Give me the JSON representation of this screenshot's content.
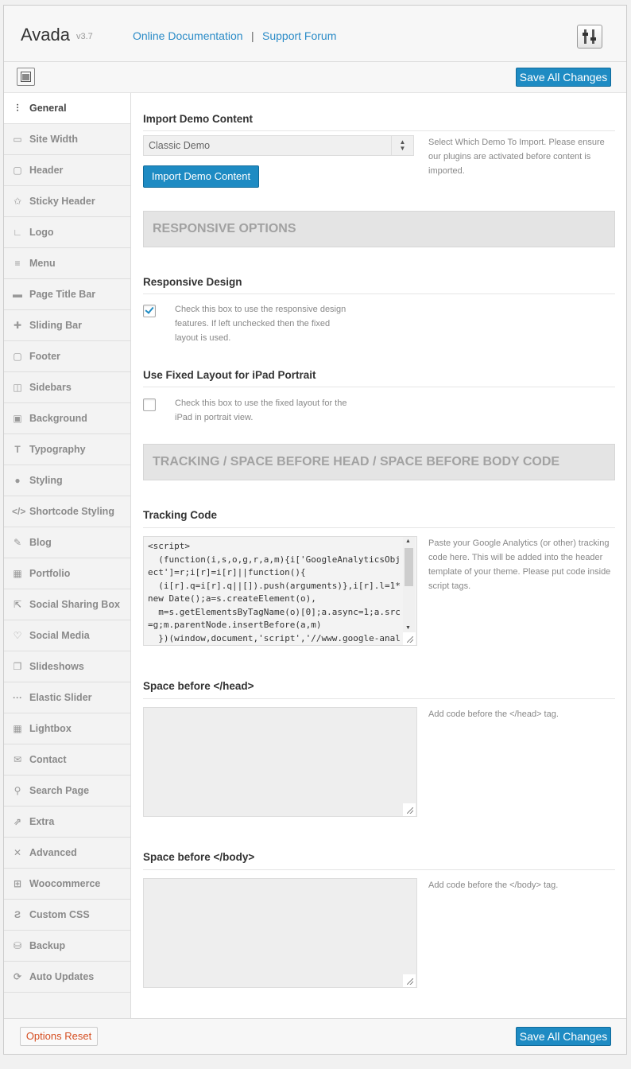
{
  "header": {
    "brand": "Avada",
    "version": "v3.7",
    "doc_link": "Online Documentation",
    "separator": "|",
    "forum_link": "Support Forum"
  },
  "toolbar": {
    "save_label": "Save All Changes"
  },
  "sidebar": {
    "items": [
      {
        "label": "General",
        "icon": "sliders-icon",
        "glyph": "⫶",
        "active": true
      },
      {
        "label": "Site Width",
        "icon": "width-icon",
        "glyph": "▭"
      },
      {
        "label": "Header",
        "icon": "header-icon",
        "glyph": "▢"
      },
      {
        "label": "Sticky Header",
        "icon": "pin-icon",
        "glyph": "✩"
      },
      {
        "label": "Logo",
        "icon": "logo-icon",
        "glyph": "∟"
      },
      {
        "label": "Menu",
        "icon": "menu-icon",
        "glyph": "≡"
      },
      {
        "label": "Page Title Bar",
        "icon": "title-bar-icon",
        "glyph": "▬"
      },
      {
        "label": "Sliding Bar",
        "icon": "plus-icon",
        "glyph": "✚"
      },
      {
        "label": "Footer",
        "icon": "footer-icon",
        "glyph": "▢"
      },
      {
        "label": "Sidebars",
        "icon": "sidebar-icon",
        "glyph": "◫"
      },
      {
        "label": "Background",
        "icon": "image-icon",
        "glyph": "▣"
      },
      {
        "label": "Typography",
        "icon": "text-icon",
        "glyph": "T"
      },
      {
        "label": "Styling",
        "icon": "drop-icon",
        "glyph": "●"
      },
      {
        "label": "Shortcode Styling",
        "icon": "code-icon",
        "glyph": "</>"
      },
      {
        "label": "Blog",
        "icon": "quill-icon",
        "glyph": "✎"
      },
      {
        "label": "Portfolio",
        "icon": "portfolio-icon",
        "glyph": "▦"
      },
      {
        "label": "Social Sharing Box",
        "icon": "share-icon",
        "glyph": "⇱"
      },
      {
        "label": "Social Media",
        "icon": "heart-icon",
        "glyph": "♡"
      },
      {
        "label": "Slideshows",
        "icon": "slides-icon",
        "glyph": "❐"
      },
      {
        "label": "Elastic Slider",
        "icon": "dots-icon",
        "glyph": "···"
      },
      {
        "label": "Lightbox",
        "icon": "lightbox-icon",
        "glyph": "▦"
      },
      {
        "label": "Contact",
        "icon": "mail-icon",
        "glyph": "✉"
      },
      {
        "label": "Search Page",
        "icon": "search-icon",
        "glyph": "⚲"
      },
      {
        "label": "Extra",
        "icon": "external-icon",
        "glyph": "⇗"
      },
      {
        "label": "Advanced",
        "icon": "wrench-icon",
        "glyph": "✕"
      },
      {
        "label": "Woocommerce",
        "icon": "cart-icon",
        "glyph": "⊞"
      },
      {
        "label": "Custom CSS",
        "icon": "css-icon",
        "glyph": "Ƨ"
      },
      {
        "label": "Backup",
        "icon": "backup-icon",
        "glyph": "⛁"
      },
      {
        "label": "Auto Updates",
        "icon": "refresh-icon",
        "glyph": "⟳"
      }
    ]
  },
  "import_demo": {
    "title": "Import Demo Content",
    "selected": "Classic Demo",
    "button": "Import Demo Content",
    "description": "Select Which Demo To Import. Please ensure our plugins are activated before content is imported."
  },
  "responsive_banner": "RESPONSIVE OPTIONS",
  "responsive_design": {
    "title": "Responsive Design",
    "checked": true,
    "description": "Check this box to use the responsive design features. If left unchecked then the fixed layout is used."
  },
  "fixed_ipad": {
    "title": "Use Fixed Layout for iPad Portrait",
    "checked": false,
    "description": "Check this box to use the fixed layout for the iPad in portrait view."
  },
  "tracking_banner": "TRACKING / SPACE BEFORE HEAD / SPACE BEFORE BODY CODE",
  "tracking_code": {
    "title": "Tracking Code",
    "value": "<script>\n  (function(i,s,o,g,r,a,m){i['GoogleAnalyticsObject']=r;i[r]=i[r]||function(){\n  (i[r].q=i[r].q||[]).push(arguments)},i[r].l=1*new Date();a=s.createElement(o),\n  m=s.getElementsByTagName(o)[0];a.async=1;a.src=g;m.parentNode.insertBefore(a,m)\n  })(window,document,'script','//www.google-analytics.com/analytics.js','ga');",
    "description": "Paste your Google Analytics (or other) tracking code here. This will be added into the header template of your theme. Please put code inside script tags."
  },
  "space_head": {
    "title": "Space before </head>",
    "value": "",
    "description": "Add code before the </head> tag."
  },
  "space_body": {
    "title": "Space before </body>",
    "value": "",
    "description": "Add code before the </body> tag."
  },
  "footer": {
    "reset_label": "Options Reset",
    "save_label": "Save All Changes"
  },
  "colors": {
    "accent": "#1e8bc3",
    "link": "#2a8bc7",
    "reset": "#d54e21"
  }
}
